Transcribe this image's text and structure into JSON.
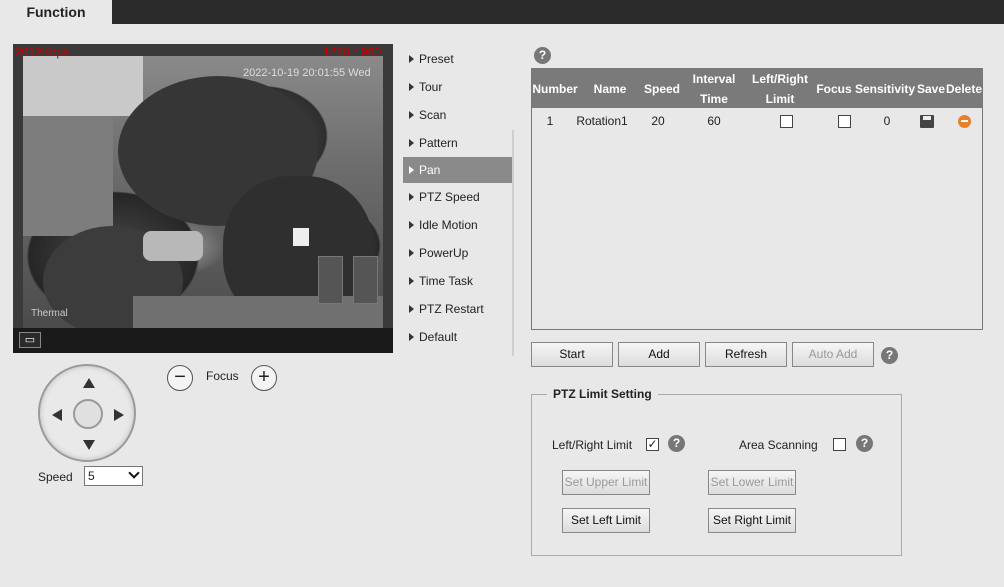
{
  "header": {
    "tab_label": "Function"
  },
  "video": {
    "bitrate": "2012Kbps",
    "resolution": "1280 * 960",
    "timestamp": "2022-10-19 20:01:55 Wed",
    "channel_label": "Thermal"
  },
  "ptz": {
    "focus_label": "Focus",
    "focus_minus": "−",
    "focus_plus": "+",
    "speed_label": "Speed",
    "speed_value": "5"
  },
  "menu": {
    "items": [
      "Preset",
      "Tour",
      "Scan",
      "Pattern",
      "Pan",
      "PTZ Speed",
      "Idle Motion",
      "PowerUp",
      "Time Task",
      "PTZ Restart",
      "Default"
    ],
    "active": "Pan"
  },
  "help_glyph": "?",
  "table": {
    "headers": {
      "number": "Number",
      "name": "Name",
      "speed": "Speed",
      "interval_time": "Interval Time",
      "left_right_limit": "Left/Right Limit",
      "focus": "Focus",
      "sensitivity": "Sensitivity",
      "save": "Save",
      "delete": "Delete"
    },
    "rows": [
      {
        "number": "1",
        "name": "Rotation1",
        "speed": "20",
        "interval_time": "60",
        "left_right_limit": false,
        "focus": false,
        "sensitivity": "0"
      }
    ]
  },
  "actions": {
    "start": "Start",
    "add": "Add",
    "refresh": "Refresh",
    "auto_add": "Auto Add"
  },
  "limit_setting": {
    "title": "PTZ Limit Setting",
    "left_right_limit_label": "Left/Right Limit",
    "left_right_limit_checked": true,
    "area_scanning_label": "Area Scanning",
    "area_scanning_checked": false,
    "check_mark": "✓",
    "set_upper_limit": "Set Upper Limit",
    "set_lower_limit": "Set Lower Limit",
    "set_left_limit": "Set Left Limit",
    "set_right_limit": "Set Right Limit"
  }
}
